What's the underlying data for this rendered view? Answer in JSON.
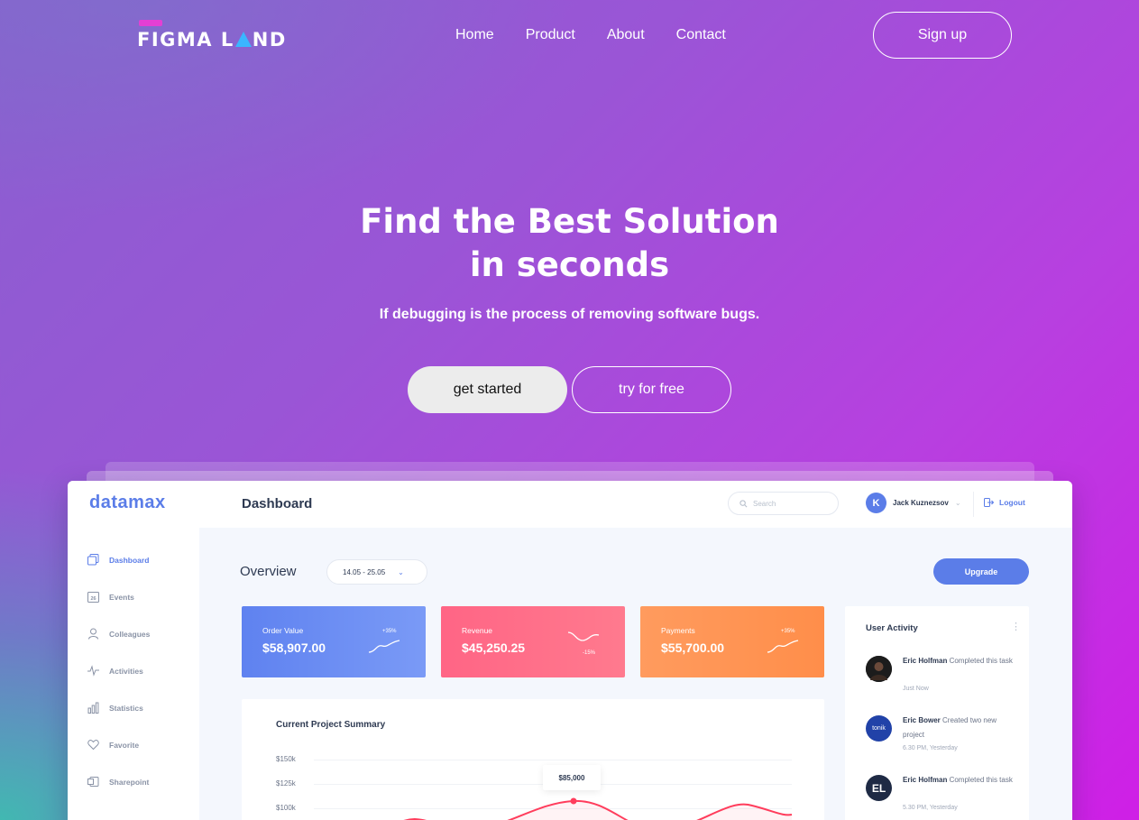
{
  "brand": {
    "logo_text": "FIGMA LAND"
  },
  "nav": {
    "items": [
      "Home",
      "Product",
      "About",
      "Contact"
    ],
    "signup_label": "Sign up"
  },
  "hero": {
    "title_line1": "Find the Best Solution",
    "title_line2": "in seconds",
    "subtitle": "If debugging is the process of removing software bugs.",
    "primary_cta": "get started",
    "secondary_cta": "try for free"
  },
  "dashboard": {
    "logo": "datamax",
    "title": "Dashboard",
    "search_placeholder": "Search",
    "user_name": "Jack Kuznezsov",
    "user_initial": "K",
    "logout_label": "Logout",
    "sidebar": [
      {
        "label": "Dashboard",
        "icon": "dashboard-icon",
        "active": true
      },
      {
        "label": "Events",
        "icon": "calendar-icon",
        "active": false
      },
      {
        "label": "Colleagues",
        "icon": "user-icon",
        "active": false
      },
      {
        "label": "Activities",
        "icon": "pulse-icon",
        "active": false
      },
      {
        "label": "Statistics",
        "icon": "chart-icon",
        "active": false
      },
      {
        "label": "Favorite",
        "icon": "heart-icon",
        "active": false
      },
      {
        "label": "Sharepoint",
        "icon": "share-icon",
        "active": false
      }
    ],
    "calendar_day": "26",
    "overview_title": "Overview",
    "date_range": "14.05 - 25.05",
    "upgrade_label": "Upgrade",
    "cards": [
      {
        "label": "Order Value",
        "value": "$58,907.00",
        "change": "+35%",
        "color": "#6b8af0"
      },
      {
        "label": "Revenue",
        "value": "$45,250.25",
        "change": "-15%",
        "color": "#ff6e87"
      },
      {
        "label": "Payments",
        "value": "$55,700.00",
        "change": "+35%",
        "color": "#ff9a55"
      }
    ],
    "summary": {
      "title": "Current Project Summary",
      "y_labels": [
        "$150k",
        "$125k",
        "$100k"
      ],
      "tooltip": "$85,000"
    },
    "activity": {
      "title": "User Activity",
      "items": [
        {
          "name": "Eric Holfman",
          "action": "Completed this task",
          "time": "Just Now",
          "avatar": "",
          "avatar_color": "#222222"
        },
        {
          "name": "Eric Bower",
          "action": "Created two new project",
          "time": "6.30 PM, Yesterday",
          "avatar": "tonik",
          "avatar_color": "#2142a8"
        },
        {
          "name": "Eric Holfman",
          "action": "Completed this task",
          "time": "5.30 PM, Yesterday",
          "avatar": "EL",
          "avatar_color": "#1e2a44"
        }
      ]
    }
  }
}
